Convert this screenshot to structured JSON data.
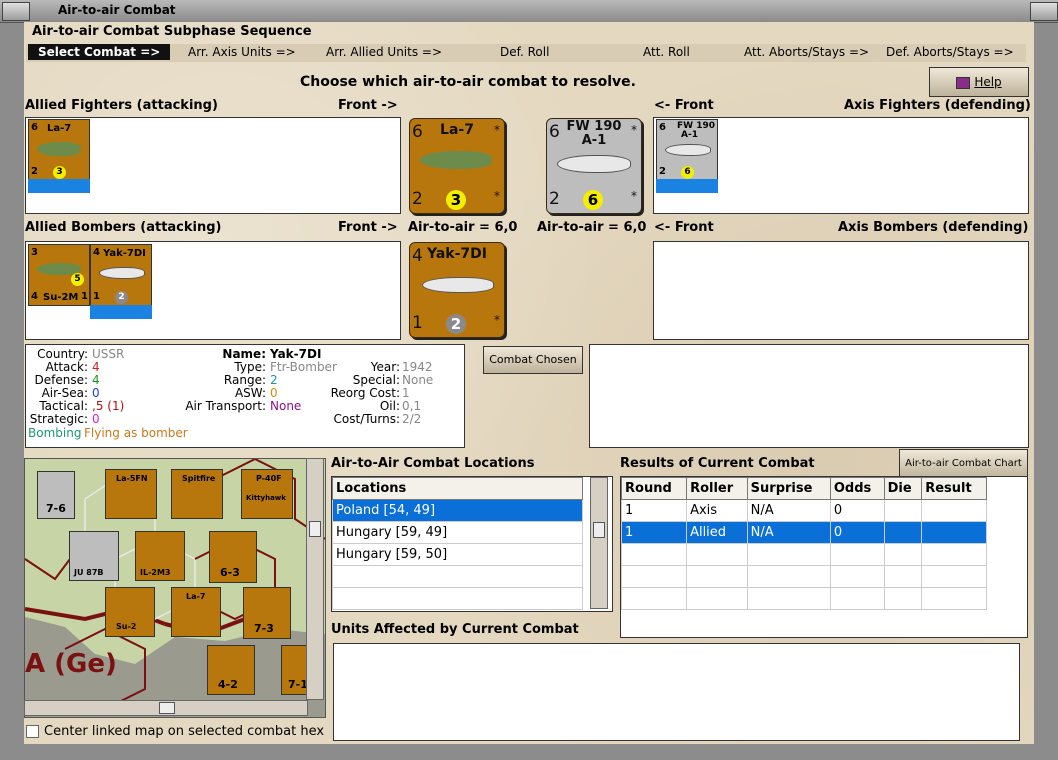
{
  "window": {
    "title": "Air-to-air Combat"
  },
  "sequence": {
    "title": "Air-to-air Combat Subphase Sequence",
    "steps": [
      "Select Combat =>",
      "Arr. Axis Units =>",
      "Arr. Allied Units =>",
      "Def. Roll",
      "Att. Roll",
      "Att. Aborts/Stays =>",
      "Def. Aborts/Stays =>"
    ]
  },
  "prompt": "Choose which air-to-air combat to resolve.",
  "help_label": "Help",
  "fighters": {
    "allied_label": "Allied Fighters (attacking)",
    "front_right": "Front ->",
    "front_left": "<- Front",
    "axis_label": "Axis Fighters (defending)"
  },
  "bombers": {
    "allied_label": "Allied Bombers (attacking)",
    "front_right": "Front ->",
    "front_left": "<- Front",
    "axis_label": "Axis Bombers (defending)",
    "air_to_air_left": "Air-to-air = 6,0",
    "air_to_air_right": "Air-to-air = 6,0"
  },
  "counters": {
    "la7": {
      "name": "La-7",
      "attack": "6",
      "defense": "2",
      "range": "3",
      "star": "*"
    },
    "fw190": {
      "name": "FW 190",
      "sub": "A-1",
      "attack": "6",
      "defense": "2",
      "range": "6",
      "star": "*"
    },
    "yak7": {
      "name": "Yak-7DI",
      "attack": "4",
      "defense": "1",
      "range": "2",
      "star": "*"
    },
    "su2": {
      "name": "Su-2M",
      "attack": "3",
      "defense": "4",
      "range": "5",
      "extra": "1"
    }
  },
  "unit_info": {
    "country_label": "Country:",
    "country": "USSR",
    "attack_label": "Attack:",
    "attack": "4",
    "defense_label": "Defense:",
    "defense": "4",
    "airsea_label": "Air-Sea:",
    "airsea": "0",
    "tactical_label": "Tactical:",
    "tactical": ",5 (1)",
    "strategic_label": "Strategic:",
    "strategic": "0",
    "bombing": "Bombing",
    "flying": "Flying as bomber",
    "name_label": "Name:",
    "name": "Yak-7DI",
    "type_label": "Type:",
    "type": "Ftr-Bomber",
    "range_label": "Range:",
    "range": "2",
    "asw_label": "ASW:",
    "asw": "0",
    "airtransport_label": "Air Transport:",
    "airtransport": "None",
    "year_label": "Year:",
    "year": "1942",
    "special_label": "Special:",
    "special": "None",
    "reorg_label": "Reorg Cost:",
    "reorg": "1",
    "oil_label": "Oil:",
    "oil": "0,1",
    "costturns_label": "Cost/Turns:",
    "costturns": "2/2"
  },
  "combat_chosen_label": "Combat Chosen",
  "locations": {
    "title": "Air-to-Air Combat Locations",
    "header": "Locations",
    "rows": [
      "Poland [54, 49]",
      "Hungary [59, 49]",
      "Hungary [59, 50]"
    ]
  },
  "results": {
    "title": "Results of Current Combat",
    "chart_button": "Air-to-air Combat Chart",
    "headers": [
      "Round",
      "Roller",
      "Surprise",
      "Odds",
      "Die",
      "Result"
    ],
    "rows": [
      [
        "1",
        "Axis",
        "N/A",
        "0",
        "",
        ""
      ],
      [
        "1",
        "Allied",
        "N/A",
        "0",
        "",
        ""
      ]
    ]
  },
  "units_affected_title": "Units Affected by Current Combat",
  "center_map_label": "Center linked map on selected combat hex",
  "map": {
    "hex_labels": [
      "7-6",
      "6-3",
      "7-3",
      "4-2",
      "7-1"
    ],
    "region_text": "A (Ge)",
    "counter_names": [
      "La-5FN",
      "Spitfire",
      "P-40F",
      "JU 87B",
      "IL-2M3",
      "La-7",
      "Su-2",
      "Kittyhawk"
    ]
  },
  "colors": {
    "accent": "#0a6fd6",
    "counter_brown": "#b8770d",
    "parchment": "#e4d8c0"
  }
}
